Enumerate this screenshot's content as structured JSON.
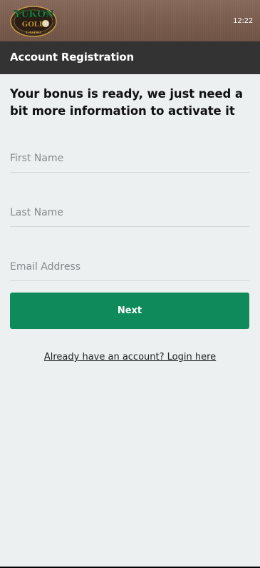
{
  "status_bar": {
    "time": "12:22"
  },
  "logo": {
    "line1": "YUKON",
    "line2": "GOLD",
    "line3": "CASINO"
  },
  "header": {
    "title": "Account Registration"
  },
  "intro": {
    "text": "Your bonus is ready, we just need a bit more information to activate it"
  },
  "form": {
    "first_name": {
      "placeholder": "First Name",
      "value": ""
    },
    "last_name": {
      "placeholder": "Last Name",
      "value": ""
    },
    "email": {
      "placeholder": "Email Address",
      "value": ""
    },
    "next_label": "Next"
  },
  "login_link": {
    "text": "Already have an account? Login here"
  },
  "colors": {
    "header_bg": "#333333",
    "page_bg": "#ecf0f1",
    "button_bg": "#0f8a5a",
    "top_bar_bg": "#7a5d4f",
    "logo_green": "#1f8a4c",
    "logo_gold": "#d4a94a"
  }
}
